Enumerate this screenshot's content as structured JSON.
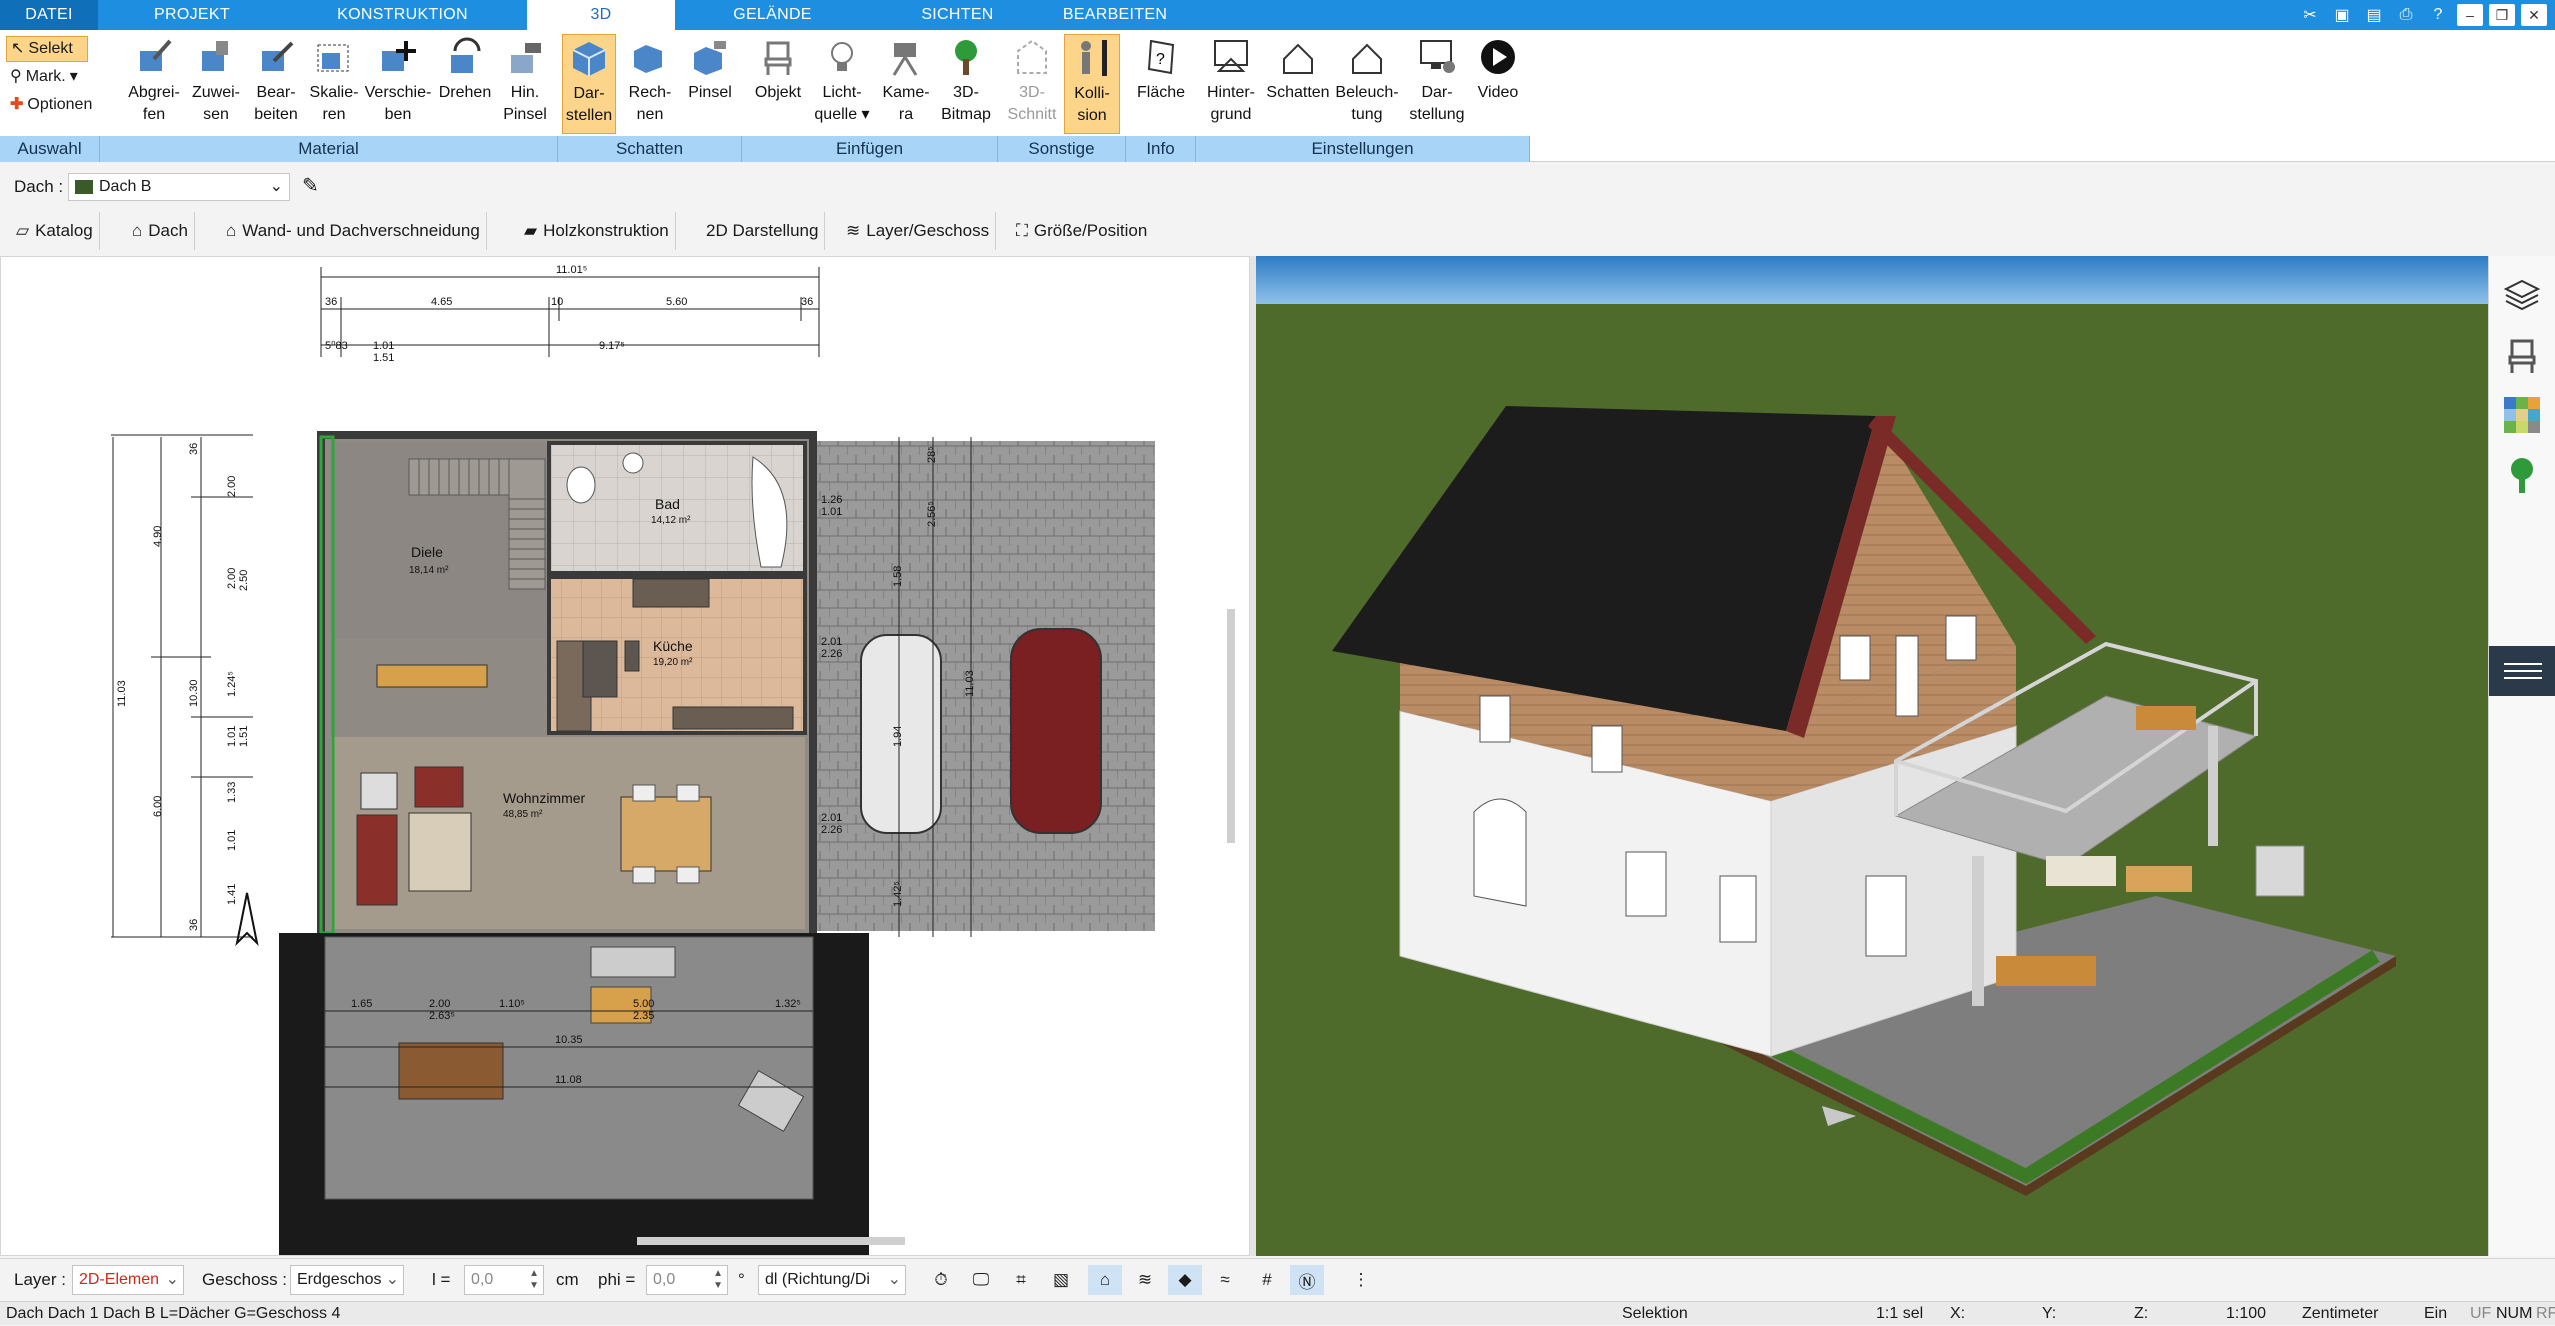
{
  "ribbon_tabs": [
    "DATEI",
    "PROJEKT",
    "KONSTRUKTION",
    "3D",
    "GELÄNDE",
    "SICHTEN",
    "BEARBEITEN"
  ],
  "active_tab": "3D",
  "auswahl": {
    "label": "Auswahl",
    "selekt": "Selekt",
    "mark": "Mark.",
    "optionen": "Optionen"
  },
  "groups": {
    "material": "Material",
    "schatten": "Schatten",
    "einfuegen": "Einfügen",
    "sonstige": "Sonstige",
    "info": "Info",
    "einstellungen": "Einstellungen"
  },
  "buttons": {
    "abgreifen": [
      "Abgrei-",
      "fen"
    ],
    "zuweisen": [
      "Zuwei-",
      "sen"
    ],
    "bearbeiten": [
      "Bear-",
      "beiten"
    ],
    "skalieren": [
      "Skalie-",
      "ren"
    ],
    "verschieben": [
      "Verschie-",
      "ben"
    ],
    "drehen": [
      "Drehen",
      ""
    ],
    "hinpinsel": [
      "Hin.",
      "Pinsel"
    ],
    "darstellen": [
      "Dar-",
      "stellen"
    ],
    "rechnen": [
      "Rech-",
      "nen"
    ],
    "pinsel": [
      "Pinsel",
      ""
    ],
    "objekt": [
      "Objekt",
      ""
    ],
    "lichtquelle": [
      "Licht-",
      "quelle"
    ],
    "kamera": [
      "Kame-",
      "ra"
    ],
    "bitmap": [
      "3D-",
      "Bitmap"
    ],
    "schnitt": [
      "3D-",
      "Schnitt"
    ],
    "kollision": [
      "Kolli-",
      "sion"
    ],
    "flaeche": [
      "Fläche",
      ""
    ],
    "hintergrund": [
      "Hinter-",
      "grund"
    ],
    "schatten": [
      "Schatten",
      ""
    ],
    "beleuchtung": [
      "Beleuch-",
      "tung"
    ],
    "darstellung": [
      "Dar-",
      "stellung"
    ],
    "video": [
      "Video",
      ""
    ]
  },
  "object_row": {
    "label": "Dach :",
    "value": "Dach B"
  },
  "tool_tabs": [
    "Katalog",
    "Dach",
    "Wand- und Dachverschneidung",
    "Holzkonstruktion",
    "2D Darstellung",
    "Layer/Geschoss",
    "Größe/Position"
  ],
  "plan": {
    "dims_top": [
      "11.01⁵",
      "36",
      "4.65",
      "10",
      "5.60",
      "36",
      "5⁰83",
      "1.01",
      "1.51",
      "9.17⁵"
    ],
    "dims_left": [
      "4.90",
      "2.00",
      "2.00",
      "2.50",
      "10.30",
      "11.03",
      "6.00",
      "1.24⁵",
      "1.01",
      "1.51",
      "1.33",
      "1.01",
      "1.41",
      "36",
      "36"
    ],
    "dims_right": [
      "28⁵",
      "1.26",
      "1.01",
      "2.56⁵",
      "1.58",
      "2.01",
      "2.26",
      "11.03",
      "1.94",
      "2.01",
      "2.26",
      "1.42⁵"
    ],
    "dims_terrace": [
      "1.65",
      "2.00",
      "2.63⁵",
      "1.10⁵",
      "5.00",
      "2.35",
      "1.32⁵",
      "10.35",
      "11.08"
    ],
    "rooms": [
      {
        "name": "Bad",
        "area": "14,12 m²"
      },
      {
        "name": "Diele",
        "area": "18,14 m²"
      },
      {
        "name": "Küche",
        "area": "19,20 m²"
      },
      {
        "name": "Wohnzimmer",
        "area": "48,85 m²"
      }
    ]
  },
  "bottom": {
    "layer_label": "Layer :",
    "layer_value": "2D-Elemen",
    "geschoss_label": "Geschoss :",
    "geschoss_value": "Erdgeschos",
    "l_label": "l =",
    "l_value": "0,0",
    "l_unit": "cm",
    "phi_label": "phi =",
    "phi_value": "0,0",
    "phi_unit": "°",
    "dl_value": "dl (Richtung/Di"
  },
  "status": {
    "info": "Dach Dach 1 Dach B L=Dächer G=Geschoss 4",
    "mode": "Selektion",
    "sel": "1:1 sel",
    "x": "X:",
    "y": "Y:",
    "z": "Z:",
    "scale": "1:100",
    "unit": "Zentimeter",
    "ein": "Ein",
    "uf": "UF",
    "num": "NUM",
    "rf": "RF"
  },
  "colors": {
    "tab_bar": "#1e8fe0",
    "group_label": "#a8d4f7",
    "highlight": "#fcd48a",
    "sky": "#3f8fd0",
    "grass": "#4f6b2b",
    "roof": "#1c1c1c",
    "wood": "#b98c66",
    "plaster": "#f2f2f2",
    "terrace": "#7e7e7e"
  }
}
